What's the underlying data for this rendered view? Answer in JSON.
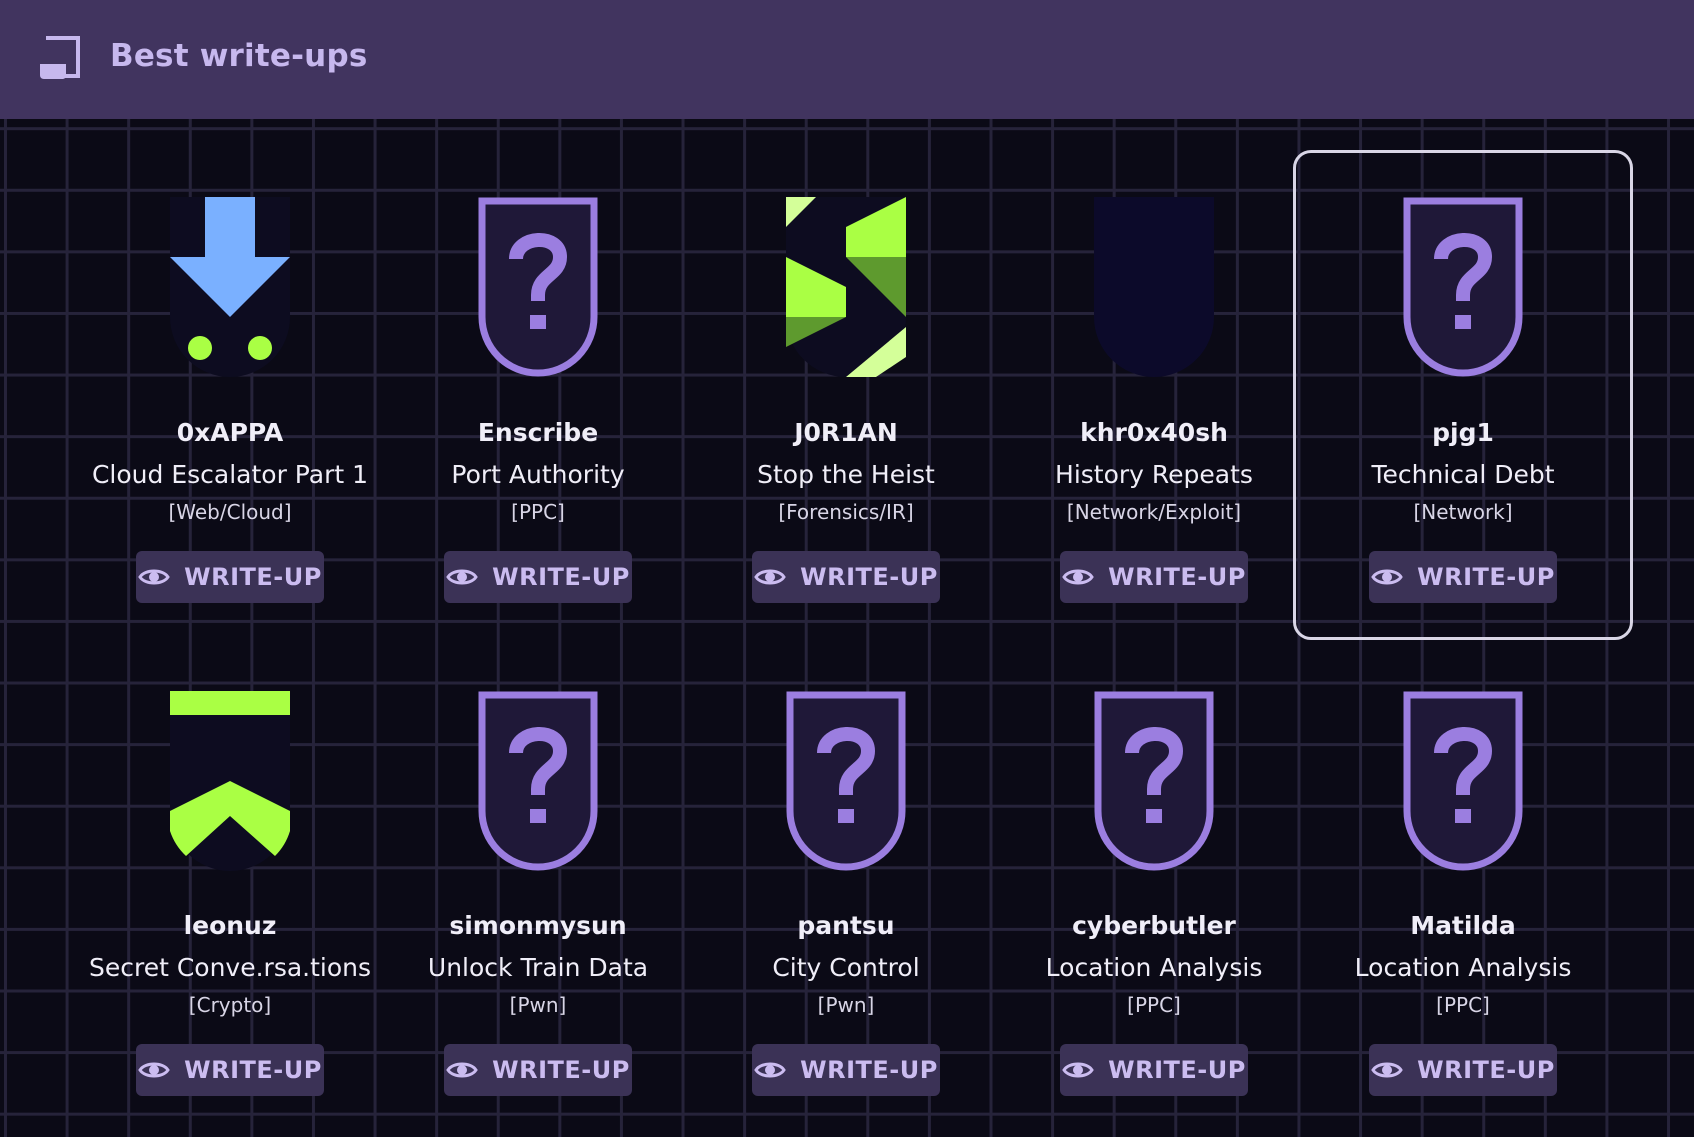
{
  "header": {
    "title": "Best write-ups",
    "icon": "writeup-document-icon"
  },
  "colors": {
    "header_bg": "#41345f",
    "page_bg": "#0b0a16",
    "grid": "#26233a",
    "accent_purple": "#9b7ee0",
    "accent_green": "#aaff44",
    "button_bg": "#3b3256",
    "button_text": "#cbbcf0"
  },
  "writeups": [
    {
      "author": "0xAPPA",
      "challenge": "Cloud Escalator Part 1",
      "category": "[Web/Cloud]",
      "button": "WRITE-UP",
      "badge": "download-arrow-badge-icon"
    },
    {
      "author": "Enscribe",
      "challenge": "Port Authority",
      "category": "[PPC]",
      "button": "WRITE-UP",
      "badge": "unknown-question-badge-icon"
    },
    {
      "author": "J0R1AN",
      "challenge": "Stop the Heist",
      "category": "[Forensics/IR]",
      "button": "WRITE-UP",
      "badge": "green-s-badge-icon"
    },
    {
      "author": "khr0x40sh",
      "challenge": "History Repeats",
      "category": "[Network/Exploit]",
      "button": "WRITE-UP",
      "badge": "dark-blank-badge-icon"
    },
    {
      "author": "pjg1",
      "challenge": "Technical Debt",
      "category": "[Network]",
      "button": "WRITE-UP",
      "badge": "unknown-question-badge-icon"
    },
    {
      "author": "leonuz",
      "challenge": "Secret Conve.rsa.tions",
      "category": "[Crypto]",
      "button": "WRITE-UP",
      "badge": "green-chevron-badge-icon"
    },
    {
      "author": "simonmysun",
      "challenge": "Unlock Train Data",
      "category": "[Pwn]",
      "button": "WRITE-UP",
      "badge": "unknown-question-badge-icon"
    },
    {
      "author": "pantsu",
      "challenge": "City Control",
      "category": "[Pwn]",
      "button": "WRITE-UP",
      "badge": "unknown-question-badge-icon"
    },
    {
      "author": "cyberbutler",
      "challenge": "Location Analysis",
      "category": "[PPC]",
      "button": "WRITE-UP",
      "badge": "unknown-question-badge-icon"
    },
    {
      "author": "Matilda",
      "challenge": "Location Analysis",
      "category": "[PPC]",
      "button": "WRITE-UP",
      "badge": "unknown-question-badge-icon"
    }
  ]
}
